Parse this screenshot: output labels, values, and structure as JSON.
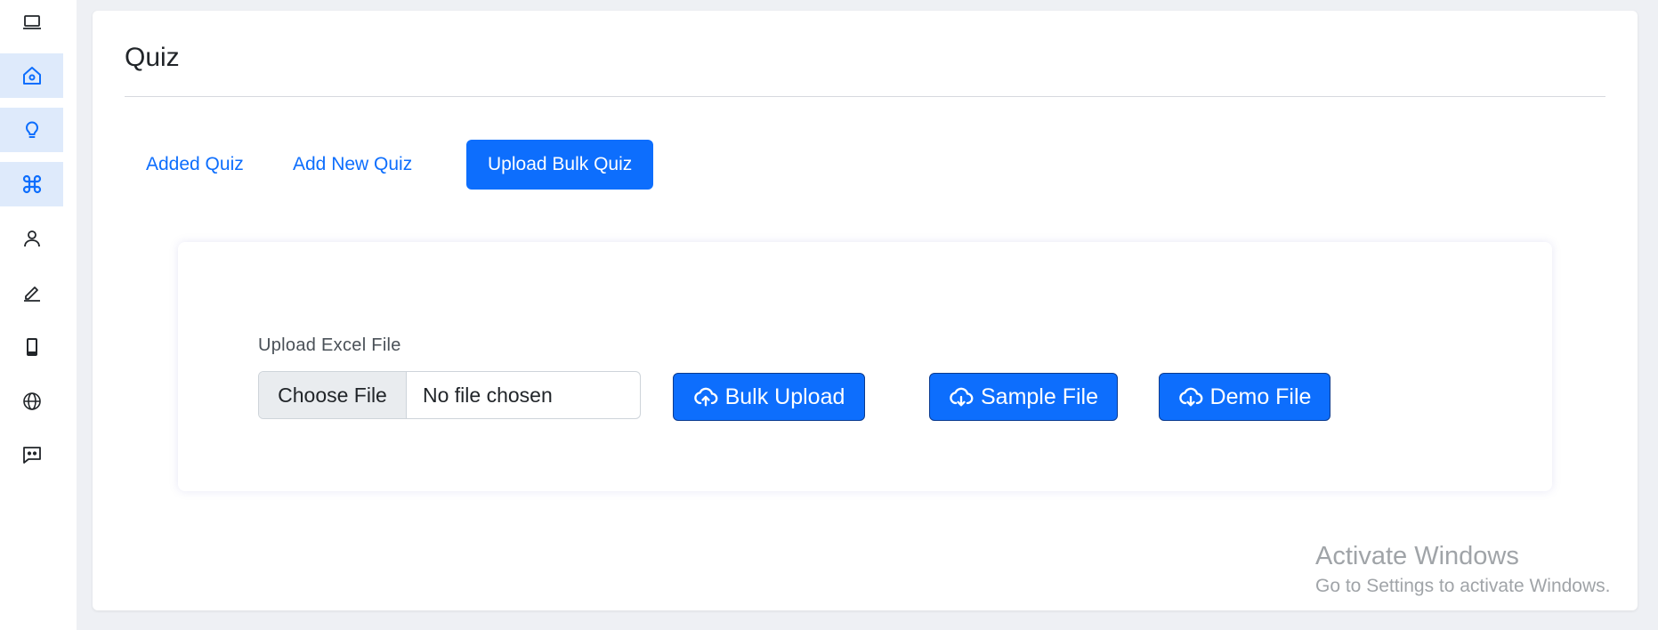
{
  "sidebar": {
    "items": [
      {
        "icon": "laptop-icon",
        "active": false
      },
      {
        "icon": "home-icon",
        "active": true
      },
      {
        "icon": "lightbulb-icon",
        "active": true
      },
      {
        "icon": "command-icon",
        "active": true
      },
      {
        "icon": "person-icon",
        "active": false
      },
      {
        "icon": "pencil-icon",
        "active": false
      },
      {
        "icon": "phone-icon",
        "active": false
      },
      {
        "icon": "globe-icon",
        "active": false
      },
      {
        "icon": "chat-icon",
        "active": false
      }
    ]
  },
  "page": {
    "title": "Quiz"
  },
  "tabs": [
    {
      "label": "Added Quiz",
      "active": false
    },
    {
      "label": "Add New Quiz",
      "active": false
    },
    {
      "label": "Upload Bulk Quiz",
      "active": true
    }
  ],
  "upload": {
    "label": "Upload Excel File",
    "choose_label": "Choose File",
    "file_status": "No file chosen",
    "bulk_upload_label": "Bulk Upload",
    "sample_file_label": "Sample File",
    "demo_file_label": "Demo File"
  },
  "watermark": {
    "title": "Activate Windows",
    "subtitle": "Go to Settings to activate Windows."
  },
  "colors": {
    "accent": "#0d6efd",
    "sidebar_active_bg": "#deeafb",
    "page_bg": "#eef0f4"
  }
}
